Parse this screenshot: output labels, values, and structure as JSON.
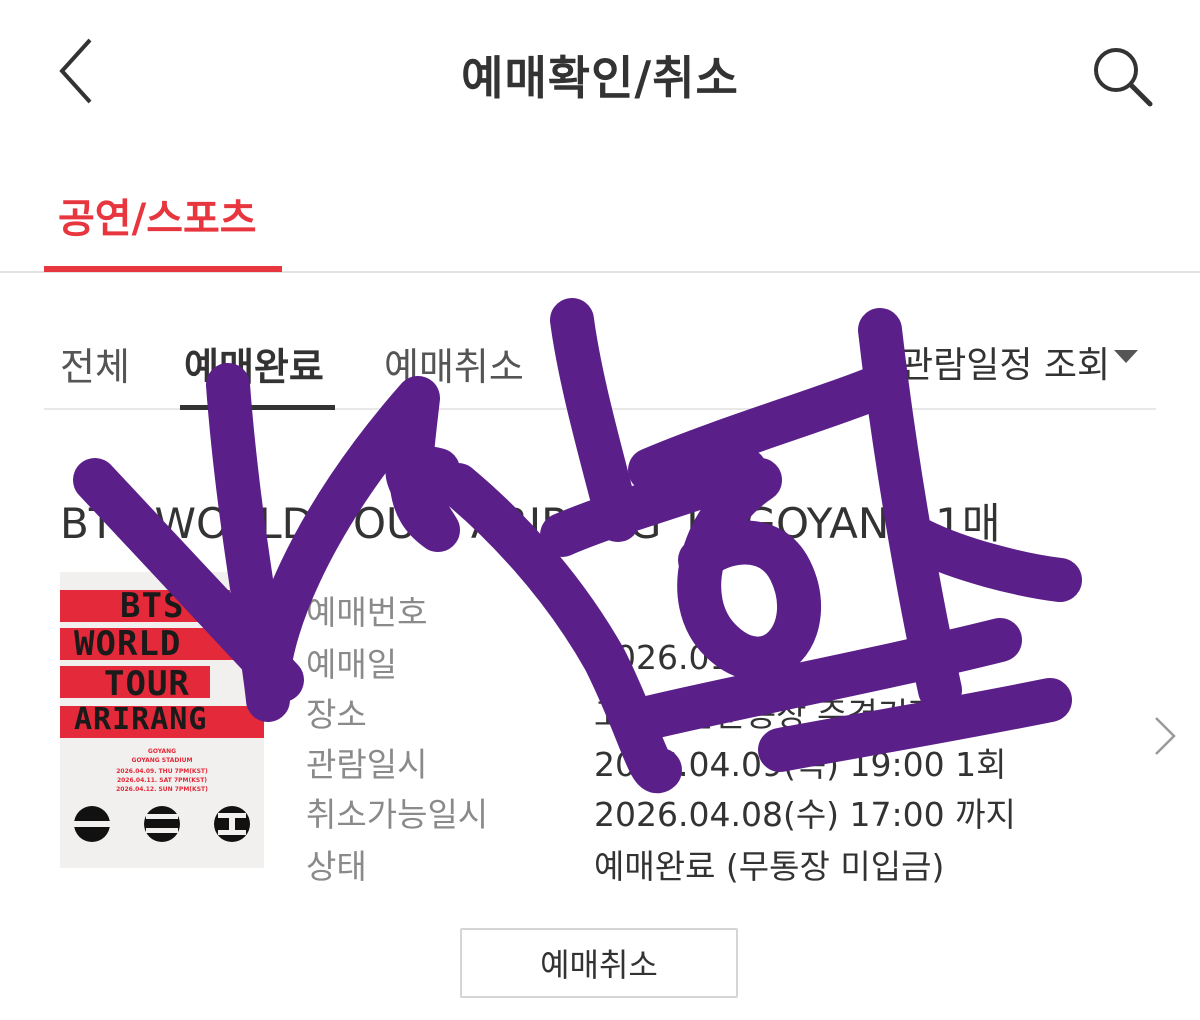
{
  "header": {
    "title": "예매확인/취소",
    "back_icon": "chevron-left-icon",
    "search_icon": "search-icon"
  },
  "category_tab": {
    "label": "공연/스포츠",
    "accent_color": "#e8363f"
  },
  "sub_tabs": [
    {
      "label": "전체",
      "active": false
    },
    {
      "label": "예매완료",
      "active": true
    },
    {
      "label": "예매취소",
      "active": false
    }
  ],
  "filter": {
    "label": "관람일정 조회"
  },
  "booking": {
    "title": "BTS WORLD TOUR 'ARIRANG' IN GOYANG 1매",
    "poster": {
      "lines": [
        "BTS",
        "WORLD",
        "TOUR",
        "ARIRANG"
      ],
      "venue": "GOYANG",
      "stadium": "GOYANG STADIUM",
      "dates": [
        "2026.04.09. THU 7PM(KST)",
        "2026.04.11. SAT 7PM(KST)",
        "2026.04.12. SUN 7PM(KST)"
      ]
    },
    "fields": [
      {
        "label": "예매번호",
        "value": ""
      },
      {
        "label": "예매일",
        "value": "2026.01.22"
      },
      {
        "label": "장소",
        "value": "고양종합운동장 주경기장"
      },
      {
        "label": "관람일시",
        "value": "2026.04.09(목) 19:00 1회"
      },
      {
        "label": "취소가능일시",
        "value": "2026.04.08(수) 17:00 까지"
      },
      {
        "label": "상태",
        "value": "예매완료 (무통장 미입금)"
      }
    ],
    "cancel_label": "예매취소"
  },
  "colors": {
    "scribble": "#5b1f8a",
    "accent": "#e8363f"
  }
}
